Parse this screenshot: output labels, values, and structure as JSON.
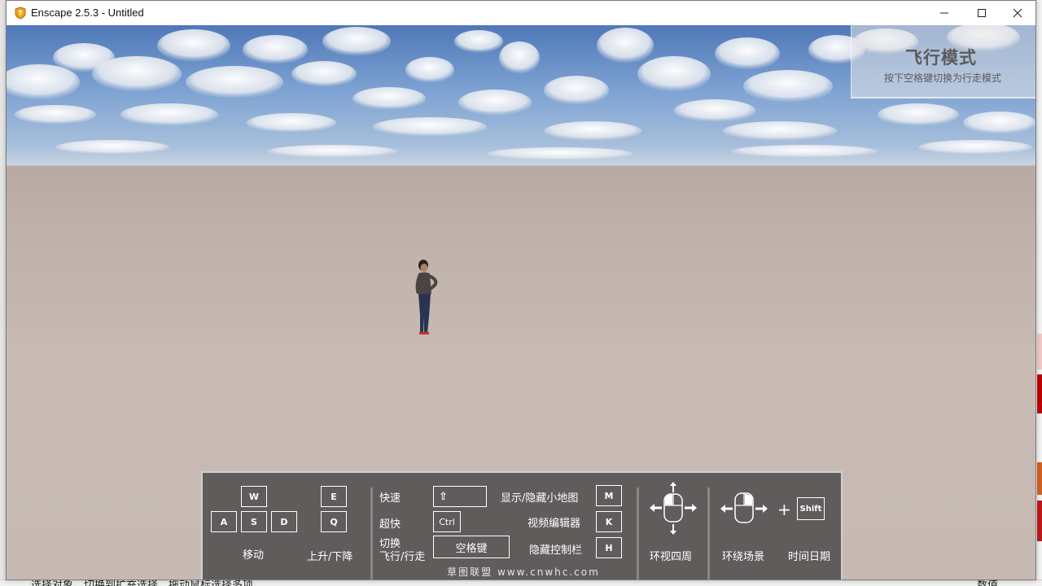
{
  "window": {
    "title": "Enscape 2.5.3 - Untitled",
    "minimize_label": "—",
    "maximize_label": "☐",
    "close_label": "✕"
  },
  "mode_panel": {
    "title": "飞行模式",
    "subtitle": "按下空格键切换为行走模式"
  },
  "controls": {
    "move": {
      "keys": [
        "W",
        "A",
        "S",
        "D"
      ],
      "label": "移动"
    },
    "updown": {
      "keys": [
        "E",
        "Q"
      ],
      "label": "上升/下降"
    },
    "fast": {
      "label": "快速",
      "key": "⇧"
    },
    "superfast": {
      "label": "超快",
      "key": "Ctrl"
    },
    "toggle": {
      "label_line1": "切换",
      "label_line2": "飞行/行走",
      "key": "空格键"
    },
    "minimap": {
      "label": "显示/隐藏小地图",
      "key": "M"
    },
    "video_editor": {
      "label": "视频编辑器",
      "key": "K"
    },
    "hide_bar": {
      "label": "隐藏控制栏",
      "key": "H"
    },
    "look_around": {
      "label": "环视四周"
    },
    "orbit": {
      "label": "环绕场景"
    },
    "time_date": {
      "plus": "+",
      "key": "Shift",
      "label": "时间日期"
    },
    "watermark": "草图联盟 www.cnwhc.com"
  },
  "host_status": {
    "left_text": "选择对象。切换到扩充选择。拖动鼠标选择多项。",
    "right_text": "数值"
  },
  "colors": {
    "control_bar_bg": "#5f5c5b",
    "sky_top": "#4f78b8",
    "ground": "#c6b9b3"
  }
}
